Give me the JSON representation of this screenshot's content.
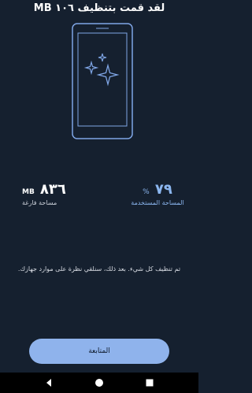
{
  "header": {
    "title": "لقد قمت بتنظيف ١٠٦ MB"
  },
  "stats": {
    "free": {
      "value": "٨٣٦",
      "unit": "MB",
      "label": "مساحة فارغة"
    },
    "used": {
      "value": "٧٩",
      "unit": "%",
      "label": "المساحة المستخدمة"
    }
  },
  "message": "تم تنظيف كل شيء. بعد ذلك، سنلقي نظرة على موارد جهازك.",
  "continue_button": {
    "label": "المتابعة"
  },
  "colors": {
    "background": "#15202f",
    "accent": "#8fb3ec",
    "illustration": "#7fa6e6"
  },
  "icons": {
    "navigation": [
      "back-icon",
      "home-icon",
      "recents-icon"
    ]
  }
}
